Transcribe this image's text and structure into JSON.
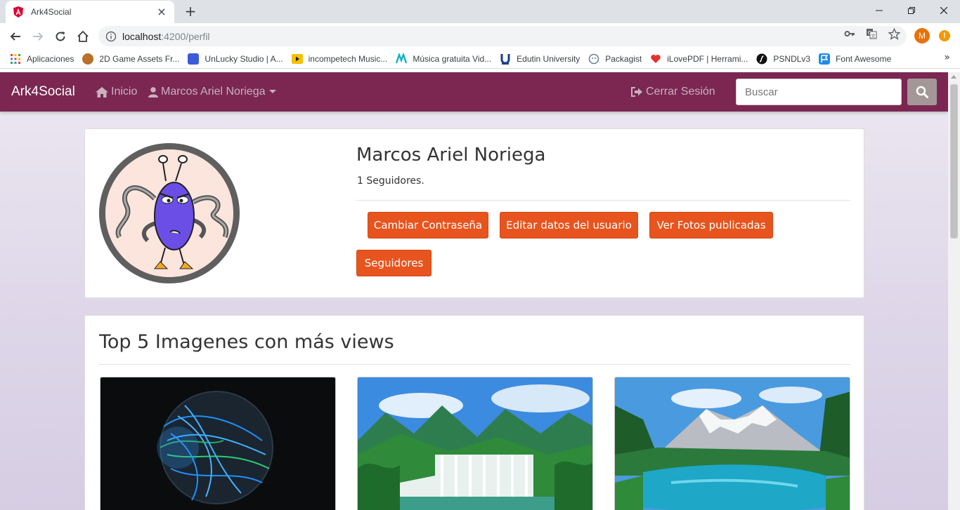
{
  "browser": {
    "tab_title": "Ark4Social",
    "url_host": "localhost",
    "url_rest": ":4200/perfil",
    "profile_initial": "M",
    "alert_glyph": "!",
    "bookmarks": [
      {
        "label": "Aplicaciones",
        "icon": "apps-grid-icon",
        "color": "#e94235"
      },
      {
        "label": "2D Game Assets Fr...",
        "icon": "game-assets-icon",
        "color": "#b8702a"
      },
      {
        "label": "UnLucky Studio | A...",
        "icon": "unlucky-icon",
        "color": "#3b5bdb"
      },
      {
        "label": "incompetech Music...",
        "icon": "play-icon",
        "color": "#f6c000"
      },
      {
        "label": "Música gratuita Vid...",
        "icon": "music-icon",
        "color": "#19b5c7"
      },
      {
        "label": "Edutin University",
        "icon": "edutin-icon",
        "color": "#1a3d8f"
      },
      {
        "label": "Packagist",
        "icon": "packagist-icon",
        "color": "#6c7a89"
      },
      {
        "label": "iLovePDF | Herrami...",
        "icon": "heart-icon",
        "color": "#e5322d"
      },
      {
        "label": "PSNDLv3",
        "icon": "symfony-icon",
        "color": "#111111"
      },
      {
        "label": "Font Awesome",
        "icon": "flag-icon",
        "color": "#228ae6"
      }
    ],
    "more_glyph": "»"
  },
  "navbar": {
    "brand": "Ark4Social",
    "home": "Inicio",
    "user": "Marcos Ariel Noriega",
    "logout": "Cerrar Sesión",
    "search_placeholder": "Buscar",
    "bg_color": "#7b2752"
  },
  "profile": {
    "name": "Marcos Ariel Noriega",
    "followers": "1 Seguidores.",
    "buttons": {
      "change_password": "Cambiar Contraseña",
      "edit_user": "Editar datos del usuario",
      "view_photos": "Ver Fotos publicadas",
      "followers": "Seguidores"
    },
    "button_color": "#e8541e"
  },
  "top_images": {
    "title": "Top 5 Imagenes con más views",
    "images": [
      {
        "name": "earth-globe-image"
      },
      {
        "name": "waterfall-image"
      },
      {
        "name": "mountain-lake-image"
      }
    ]
  }
}
